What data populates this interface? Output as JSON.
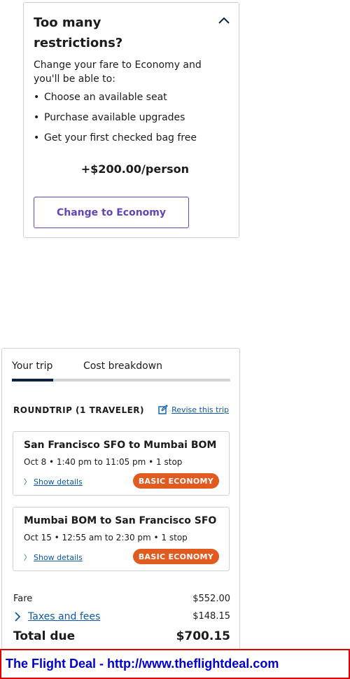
{
  "restrictions": {
    "title": "Too many restrictions?",
    "intro": "Change your fare to Economy and you'll be able to:",
    "benefits": [
      "Choose an available seat",
      "Purchase available upgrades",
      "Get your first checked bag free"
    ],
    "price": "+$200.00/person",
    "button_label": "Change to Economy"
  },
  "trip": {
    "tabs": [
      "Your trip",
      "Cost breakdown"
    ],
    "roundtrip_label": "ROUNDTRIP (1 TRAVELER)",
    "revise_label": "Revise this trip",
    "segments": [
      {
        "route": "San Francisco SFO to Mumbai BOM",
        "when": "Oct 8 • 1:40 pm to 11:05 pm • 1 stop",
        "details_label": "Show details",
        "badge": "BASIC ECONOMY"
      },
      {
        "route": "Mumbai BOM to San Francisco SFO",
        "when": "Oct 15 • 12:55 am to 2:30 pm • 1 stop",
        "details_label": "Show details",
        "badge": "BASIC ECONOMY"
      }
    ],
    "fare_label": "Fare",
    "fare_value": "$552.00",
    "taxes_label": "Taxes and fees",
    "taxes_value": "$148.15",
    "total_label": "Total due",
    "total_value": "$700.15"
  },
  "banner": {
    "text": "The Flight Deal - http://www.theflightdeal.com"
  },
  "colors": {
    "accent_purple": "#6244bb",
    "link_blue": "#0c5aa6",
    "badge_orange": "#e15a1f",
    "tab_active": "#0c2340",
    "banner_text": "#0000cc",
    "banner_border": "#e00000"
  },
  "icons": {
    "collapse": "chevron-up-icon",
    "revise": "edit-icon",
    "details": "chevron-right-icon",
    "taxes": "chevron-right-icon"
  }
}
